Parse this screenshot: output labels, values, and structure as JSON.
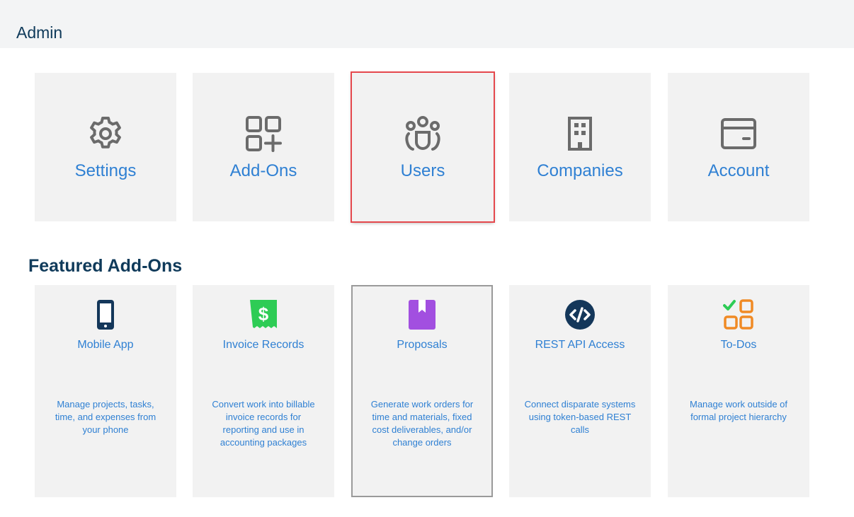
{
  "page": {
    "title": "Admin"
  },
  "admin_tiles": [
    {
      "label": "Settings",
      "icon": "gear-icon"
    },
    {
      "label": "Add-Ons",
      "icon": "add-ons-grid-icon"
    },
    {
      "label": "Users",
      "icon": "users-group-icon",
      "selected": true
    },
    {
      "label": "Companies",
      "icon": "building-icon"
    },
    {
      "label": "Account",
      "icon": "credit-card-icon"
    }
  ],
  "featured": {
    "title": "Featured Add-Ons",
    "items": [
      {
        "label": "Mobile App",
        "icon": "mobile-phone-icon",
        "icon_color": "#14375a",
        "description": "Manage projects, tasks, time, and expenses from your phone"
      },
      {
        "label": "Invoice Records",
        "icon": "invoice-dollar-icon",
        "icon_color": "#2ecc55",
        "description": "Convert work into billable invoice records for reporting and use in accounting packages"
      },
      {
        "label": "Proposals",
        "icon": "bookmark-book-icon",
        "icon_color": "#a24fe0",
        "description": "Generate work orders for time and materials, fixed cost deliverables, and/or change orders"
      },
      {
        "label": "REST API Access",
        "icon": "code-brackets-icon",
        "icon_color": "#14375a",
        "description": "Connect disparate systems using token-based REST calls"
      },
      {
        "label": "To-Dos",
        "icon": "todo-checklist-icon",
        "icon_color": "#f08a24",
        "description": "Manage work outside of formal project hierarchy"
      }
    ]
  },
  "colors": {
    "accent": "#2f80d3",
    "heading": "#0f3a5a",
    "tile_bg": "#f2f2f2",
    "selected_outline": "#e5484d",
    "icon_gray": "#6b6b6b"
  }
}
